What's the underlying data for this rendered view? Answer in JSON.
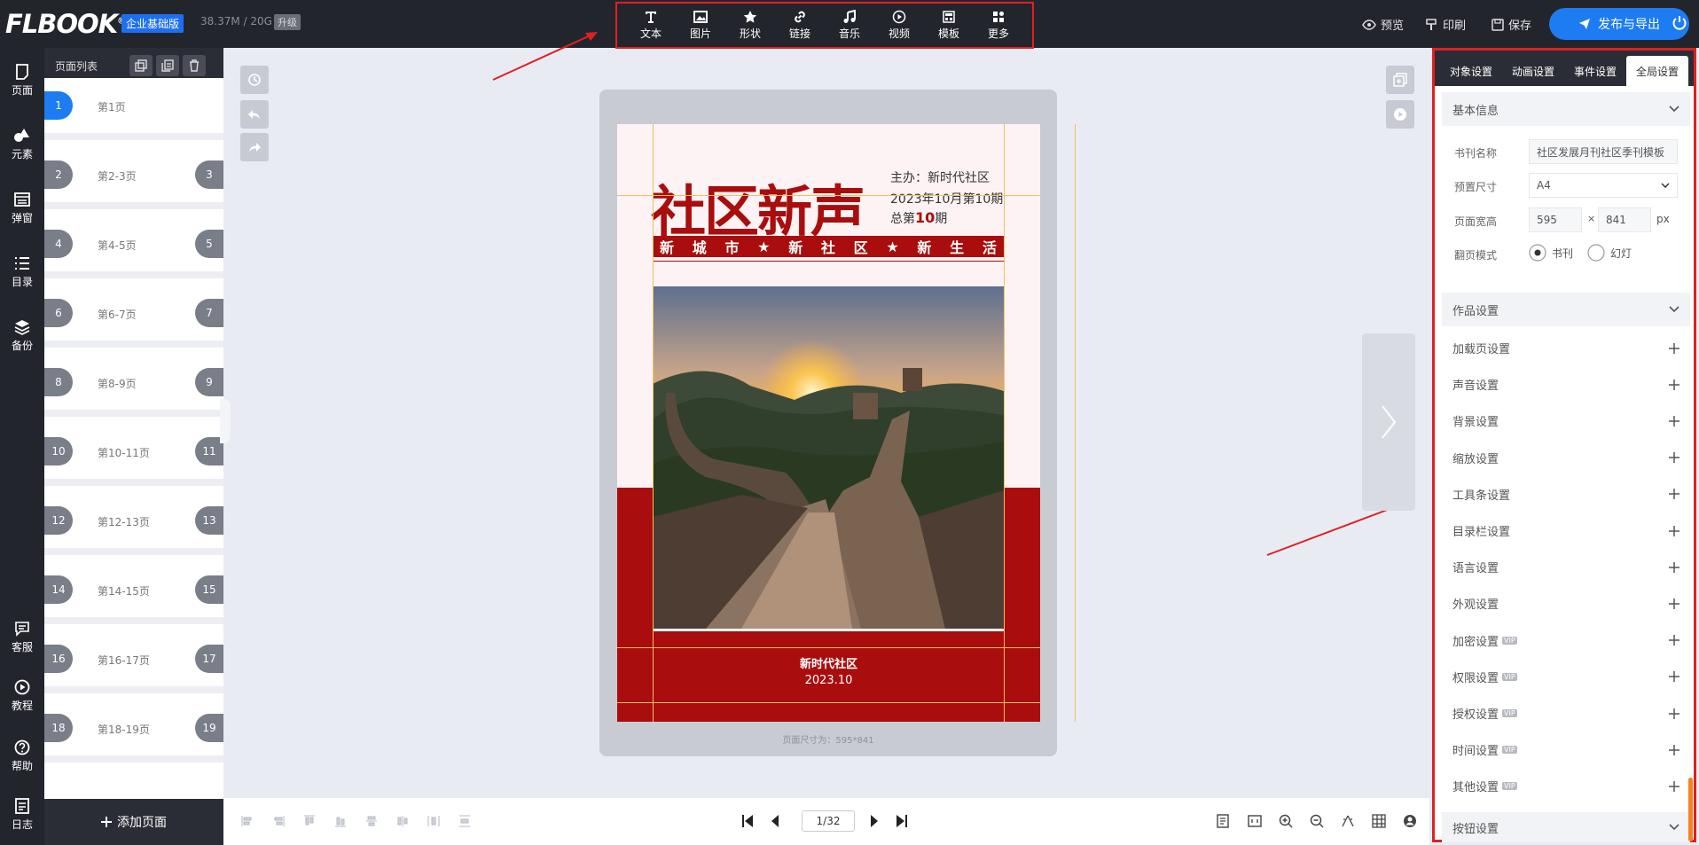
{
  "app": {
    "logo": "FLBOOK",
    "logo_reg": "®",
    "edition": "企业基础版",
    "storage": "38.37M / 20G",
    "upgrade": "升级"
  },
  "toolbar": {
    "items": [
      {
        "label": "文本",
        "icon": "text-icon"
      },
      {
        "label": "图片",
        "icon": "image-icon"
      },
      {
        "label": "形状",
        "icon": "star-icon"
      },
      {
        "label": "链接",
        "icon": "link-icon"
      },
      {
        "label": "音乐",
        "icon": "music-icon"
      },
      {
        "label": "视频",
        "icon": "video-icon"
      },
      {
        "label": "模板",
        "icon": "template-icon"
      },
      {
        "label": "更多",
        "icon": "more-icon"
      }
    ]
  },
  "header_actions": {
    "preview": "预览",
    "print": "印刷",
    "save": "保存",
    "publish": "发布与导出"
  },
  "rail": [
    "页面",
    "元素",
    "弹窗",
    "目录",
    "备份",
    "客服",
    "教程",
    "帮助",
    "日志"
  ],
  "page_panel": {
    "title": "页面列表",
    "pages": [
      {
        "label": "第1页",
        "left": "1",
        "right": ""
      },
      {
        "label": "第2-3页",
        "left": "2",
        "right": "3"
      },
      {
        "label": "第4-5页",
        "left": "4",
        "right": "5"
      },
      {
        "label": "第6-7页",
        "left": "6",
        "right": "7"
      },
      {
        "label": "第8-9页",
        "left": "8",
        "right": "9"
      },
      {
        "label": "第10-11页",
        "left": "10",
        "right": "11"
      },
      {
        "label": "第12-13页",
        "left": "12",
        "right": "13"
      },
      {
        "label": "第14-15页",
        "left": "14",
        "right": "15"
      },
      {
        "label": "第16-17页",
        "left": "16",
        "right": "17"
      },
      {
        "label": "第18-19页",
        "left": "18",
        "right": "19"
      }
    ],
    "add_page": "添加页面"
  },
  "book": {
    "title": "社区新声",
    "organizer": "主办：新时代社区",
    "issue_date": "2023年10月第10期",
    "total_prefix": "总第",
    "total_num": "10",
    "total_suffix": "期",
    "slogan": [
      "新",
      "城",
      "市",
      "★",
      "新",
      "社",
      "区",
      "★",
      "新",
      "生",
      "活"
    ],
    "footer_name": "新时代社区",
    "footer_date": "2023.10",
    "page_size": "页面尺寸为：595*841"
  },
  "pager": {
    "current": "1/32"
  },
  "right_panel": {
    "tabs": [
      "对象设置",
      "动画设置",
      "事件设置",
      "全局设置"
    ],
    "active_tab": "全局设置",
    "basic": {
      "title": "基本信息",
      "name_label": "书刊名称",
      "name_value": "社区发展月刊社区季刊模板",
      "size_label": "预置尺寸",
      "size_value": "A4",
      "dim_label": "页面宽高",
      "width": "595",
      "times": "×",
      "height": "841",
      "unit": "px",
      "mode_label": "翻页模式",
      "mode_book": "书刊",
      "mode_slide": "幻灯"
    },
    "work_title": "作品设置",
    "settings": [
      {
        "label": "加载页设置",
        "vip": false
      },
      {
        "label": "声音设置",
        "vip": false
      },
      {
        "label": "背景设置",
        "vip": false
      },
      {
        "label": "缩放设置",
        "vip": false
      },
      {
        "label": "工具条设置",
        "vip": false
      },
      {
        "label": "目录栏设置",
        "vip": false
      },
      {
        "label": "语言设置",
        "vip": false
      },
      {
        "label": "外观设置",
        "vip": false
      },
      {
        "label": "加密设置",
        "vip": true
      },
      {
        "label": "权限设置",
        "vip": true
      },
      {
        "label": "授权设置",
        "vip": true
      },
      {
        "label": "时间设置",
        "vip": true
      },
      {
        "label": "其他设置",
        "vip": true
      }
    ],
    "vip_label": "VIP",
    "button_title": "按钮设置"
  },
  "colors": {
    "accent": "#1e7cf2",
    "brand_red": "#a90d0d",
    "annotation": "#e02020"
  }
}
